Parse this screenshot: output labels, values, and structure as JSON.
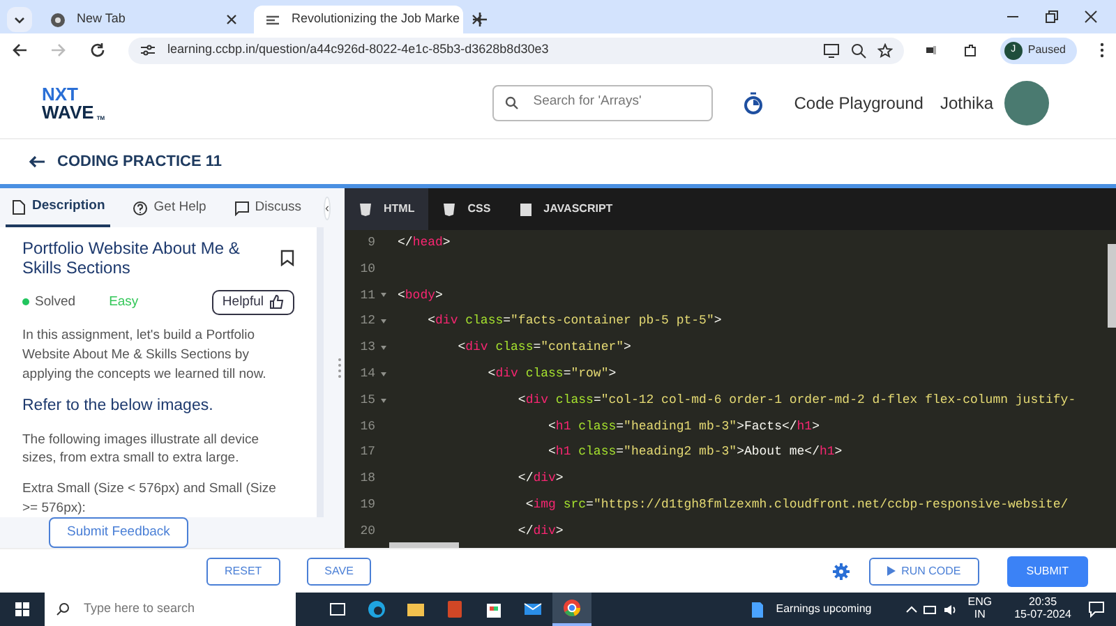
{
  "browser": {
    "tabs": [
      {
        "title": "New Tab",
        "selected": false
      },
      {
        "title": "Revolutionizing the Job Marke",
        "selected": true
      }
    ],
    "url": "learning.ccbp.in/question/a44c926d-8022-4e1c-85b3-d3628b8d30e3",
    "forward_disabled": true,
    "profile": {
      "initial": "J",
      "label": "Paused"
    }
  },
  "header": {
    "logo": {
      "line_1": "NXT",
      "line_2": "WAVE",
      "mark": "TM"
    },
    "search": {
      "placeholder": "Search for 'Arrays'"
    },
    "links": [
      "Code Playground"
    ],
    "user": "Jothika"
  },
  "page_title": "CODING PRACTICE 11",
  "side_tabs": [
    {
      "label": "Description",
      "selected": true
    },
    {
      "label": "Get Help",
      "selected": false
    },
    {
      "label": "Discuss",
      "selected": false
    }
  ],
  "collapse": "‹",
  "problem": {
    "title": "Portfolio Website About Me & Skills Sections",
    "status": {
      "text": "Solved",
      "color": "#22c55e"
    },
    "difficulty": "Easy",
    "helpful": "Helpful",
    "body": [
      {
        "kind": "p",
        "text": "In this assignment, let's build a Portfolio Website About Me & Skills Sections by applying the concepts we learned till now."
      },
      {
        "kind": "h",
        "text": "Refer to the below images."
      },
      {
        "kind": "p",
        "text": "The following images illustrate all device sizes, from extra small to extra large."
      },
      {
        "kind": "p",
        "text": "Extra Small (Size < 576px) and Small (Size >= 576px):"
      }
    ]
  },
  "feedback": "Submit Feedback",
  "editor_tabs": [
    {
      "label": "HTML",
      "selected": true
    },
    {
      "label": "CSS",
      "selected": false
    },
    {
      "label": "JAVASCRIPT",
      "selected": false
    }
  ],
  "code": [
    {
      "n": "9",
      "fold": false,
      "tokens": [
        {
          "kind": "p",
          "t": "</"
        },
        {
          "kind": "tag",
          "t": "head"
        },
        {
          "kind": "p",
          "t": ">"
        }
      ]
    },
    {
      "n": "10",
      "fold": false
    },
    {
      "n": "11",
      "fold": true,
      "tokens": [
        {
          "kind": "p",
          "t": "<"
        },
        {
          "kind": "tag",
          "t": "body"
        },
        {
          "kind": "p",
          "t": ">"
        }
      ]
    },
    {
      "n": "12",
      "fold": true,
      "tokens": [
        {
          "kind": "p",
          "t": "    <"
        },
        {
          "kind": "tag",
          "t": "div"
        },
        {
          "kind": "attr",
          "t": " class"
        },
        {
          "kind": "p",
          "t": "="
        },
        {
          "kind": "str",
          "t": "\"facts-container pb-5 pt-5\""
        },
        {
          "kind": "p",
          "t": ">"
        }
      ]
    },
    {
      "n": "13",
      "fold": true,
      "tokens": [
        {
          "kind": "p",
          "t": "        <"
        },
        {
          "kind": "tag",
          "t": "div"
        },
        {
          "kind": "attr",
          "t": " class"
        },
        {
          "kind": "p",
          "t": "="
        },
        {
          "kind": "str",
          "t": "\"container\""
        },
        {
          "kind": "p",
          "t": ">"
        }
      ]
    },
    {
      "n": "14",
      "fold": true,
      "tokens": [
        {
          "kind": "p",
          "t": "            <"
        },
        {
          "kind": "tag",
          "t": "div"
        },
        {
          "kind": "attr",
          "t": " class"
        },
        {
          "kind": "p",
          "t": "="
        },
        {
          "kind": "str",
          "t": "\"row\""
        },
        {
          "kind": "p",
          "t": ">"
        }
      ]
    },
    {
      "n": "15",
      "fold": true,
      "tokens": [
        {
          "kind": "p",
          "t": "                <"
        },
        {
          "kind": "tag",
          "t": "div"
        },
        {
          "kind": "attr",
          "t": " class"
        },
        {
          "kind": "p",
          "t": "="
        },
        {
          "kind": "str",
          "t": "\"col-12 col-md-6 order-1 order-md-2 d-flex flex-column justify-"
        }
      ]
    },
    {
      "n": "16",
      "fold": false,
      "tokens": [
        {
          "kind": "p",
          "t": "                    <"
        },
        {
          "kind": "tag",
          "t": "h1"
        },
        {
          "kind": "attr",
          "t": " class"
        },
        {
          "kind": "p",
          "t": "="
        },
        {
          "kind": "str",
          "t": "\"heading1 mb-3\""
        },
        {
          "kind": "p",
          "t": ">Facts</"
        },
        {
          "kind": "tag",
          "t": "h1"
        },
        {
          "kind": "p",
          "t": ">"
        }
      ]
    },
    {
      "n": "17",
      "fold": false,
      "tokens": [
        {
          "kind": "p",
          "t": "                    <"
        },
        {
          "kind": "tag",
          "t": "h1"
        },
        {
          "kind": "attr",
          "t": " class"
        },
        {
          "kind": "p",
          "t": "="
        },
        {
          "kind": "str",
          "t": "\"heading2 mb-3\""
        },
        {
          "kind": "p",
          "t": ">About me</"
        },
        {
          "kind": "tag",
          "t": "h1"
        },
        {
          "kind": "p",
          "t": ">"
        }
      ]
    },
    {
      "n": "18",
      "fold": false,
      "tokens": [
        {
          "kind": "p",
          "t": "                </"
        },
        {
          "kind": "tag",
          "t": "div"
        },
        {
          "kind": "p",
          "t": ">"
        }
      ]
    },
    {
      "n": "19",
      "fold": false,
      "tokens": [
        {
          "kind": "p",
          "t": "                 <"
        },
        {
          "kind": "tag",
          "t": "img"
        },
        {
          "kind": "attr",
          "t": " src"
        },
        {
          "kind": "p",
          "t": "="
        },
        {
          "kind": "str",
          "t": "\"https://d1tgh8fmlzexmh.cloudfront.net/ccbp-responsive-website/"
        }
      ]
    },
    {
      "n": "20",
      "fold": false,
      "tokens": [
        {
          "kind": "p",
          "t": "                </"
        },
        {
          "kind": "tag",
          "t": "div"
        },
        {
          "kind": "p",
          "t": ">"
        }
      ]
    }
  ],
  "actions": {
    "reset": "RESET",
    "save": "SAVE",
    "run": "RUN CODE",
    "submit": "SUBMIT"
  },
  "taskbar": {
    "search": {
      "placeholder": "Type here to search"
    },
    "apps": [
      {
        "selected": false
      },
      {
        "selected": false
      },
      {
        "selected": false
      },
      {
        "selected": false
      },
      {
        "selected": false
      },
      {
        "selected": false
      },
      {
        "selected": true
      }
    ],
    "news": "Earnings upcoming",
    "lang": "ENG",
    "region": "IN",
    "time": "20:35",
    "date": "15-07-2024"
  }
}
